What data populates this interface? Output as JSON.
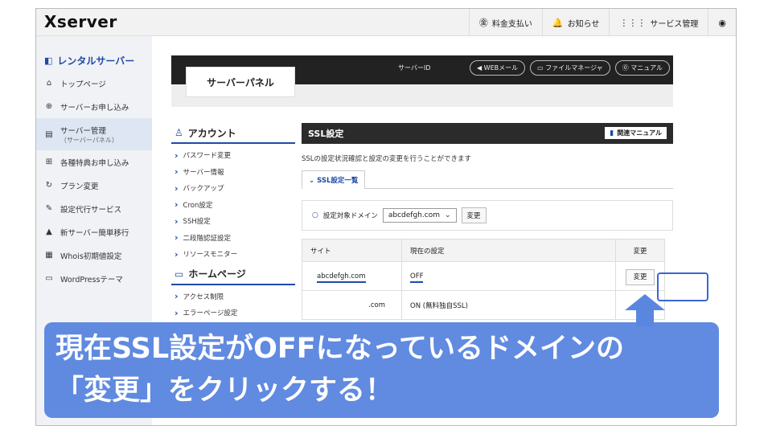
{
  "brand": "Xserver",
  "topnav": [
    {
      "icon": "yen-icon",
      "glyph": "㊎",
      "label": "料金支払い"
    },
    {
      "icon": "bell-icon",
      "glyph": "🔔",
      "label": "お知らせ"
    },
    {
      "icon": "grid-icon",
      "glyph": "⋮⋮⋮",
      "label": "サービス管理"
    },
    {
      "icon": "user-icon",
      "glyph": "◉",
      "label": ""
    }
  ],
  "sidebar": {
    "title": "レンタルサーバー",
    "items": [
      {
        "label": "トップページ",
        "sub": ""
      },
      {
        "label": "サーバーお申し込み",
        "sub": ""
      },
      {
        "label": "サーバー管理",
        "sub": "（サーバーパネル）"
      },
      {
        "label": "各種特典お申し込み",
        "sub": ""
      },
      {
        "label": "プラン変更",
        "sub": ""
      },
      {
        "label": "設定代行サービス",
        "sub": ""
      },
      {
        "label": "新サーバー簡単移行",
        "sub": ""
      },
      {
        "label": "Whois初期値設定",
        "sub": ""
      },
      {
        "label": "WordPressテーマ",
        "sub": ""
      }
    ]
  },
  "panel": {
    "title": "サーバーパネル",
    "server_id_label": "サーバーID",
    "pills": [
      "◀ WEBメール",
      "▭ ファイルマネージャ",
      "⓪ マニュアル"
    ]
  },
  "menu": {
    "account_head": "アカウント",
    "account_items": [
      "パスワード変更",
      "サーバー情報",
      "バックアップ",
      "Cron設定",
      "SSH設定",
      "二段階認証設定",
      "リソースモニター"
    ],
    "home_head": "ホームページ",
    "home_items": [
      "アクセス制限",
      "エラーページ設定"
    ]
  },
  "ssl": {
    "title": "SSL設定",
    "manual": "関連マニュアル",
    "desc": "SSLの設定状況確認と設定の変更を行うことができます",
    "tab": "SSL設定一覧",
    "domain_label": "設定対象ドメイン",
    "domain_value": "abcdefgh.com",
    "change_btn": "変更",
    "table": {
      "headers": [
        "サイト",
        "現在の設定",
        "変更"
      ],
      "rows": [
        {
          "site": "abcdefgh.com",
          "setting": "OFF",
          "action": "変更"
        },
        {
          "site": ".com",
          "setting": "ON (無料独自SSL)",
          "action": ""
        }
      ]
    }
  },
  "callout": {
    "line1": "現在SSL設定がOFFになっているドメインの",
    "line2": "「変更」をクリックする！"
  },
  "colors": {
    "accent": "#1e4aa8",
    "callout": "#5b86e0",
    "highlight": "#3a66d6"
  }
}
